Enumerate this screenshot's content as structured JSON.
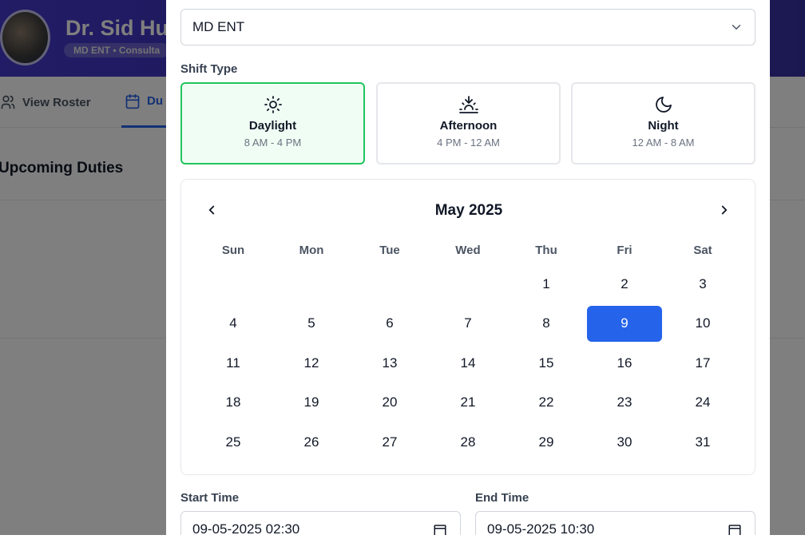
{
  "app": {
    "doctor_name": "Dr. Sid Hul",
    "doctor_subtitle": "MD ENT • Consulta",
    "tabs": [
      {
        "label": "View Roster",
        "icon": "users-icon"
      },
      {
        "label": "Du",
        "icon": "calendar-icon",
        "active": true
      }
    ],
    "section_title": "Upcoming Duties"
  },
  "modal": {
    "department_select": {
      "value": "MD ENT"
    },
    "shift_type_label": "Shift Type",
    "shifts": [
      {
        "name": "Daylight",
        "time": "8 AM - 4 PM",
        "icon": "sun-icon",
        "selected": true
      },
      {
        "name": "Afternoon",
        "time": "4 PM - 12 AM",
        "icon": "sunset-icon",
        "selected": false
      },
      {
        "name": "Night",
        "time": "12 AM - 8 AM",
        "icon": "moon-icon",
        "selected": false
      }
    ],
    "calendar": {
      "month_title": "May 2025",
      "weekdays": [
        "Sun",
        "Mon",
        "Tue",
        "Wed",
        "Thu",
        "Fri",
        "Sat"
      ],
      "weeks": [
        [
          "",
          "",
          "",
          "",
          "1",
          "2",
          "3"
        ],
        [
          "4",
          "5",
          "6",
          "7",
          "8",
          "9",
          "10"
        ],
        [
          "11",
          "12",
          "13",
          "14",
          "15",
          "16",
          "17"
        ],
        [
          "18",
          "19",
          "20",
          "21",
          "22",
          "23",
          "24"
        ],
        [
          "25",
          "26",
          "27",
          "28",
          "29",
          "30",
          "31"
        ]
      ],
      "selected_day": "9"
    },
    "start_time": {
      "label": "Start Time",
      "value": "09-05-2025 02:30"
    },
    "end_time": {
      "label": "End Time",
      "value": "09-05-2025 10:30"
    }
  },
  "colors": {
    "accent": "#2563eb",
    "selected_shift_border": "#22c55e",
    "header_bg": "#4338ca"
  }
}
